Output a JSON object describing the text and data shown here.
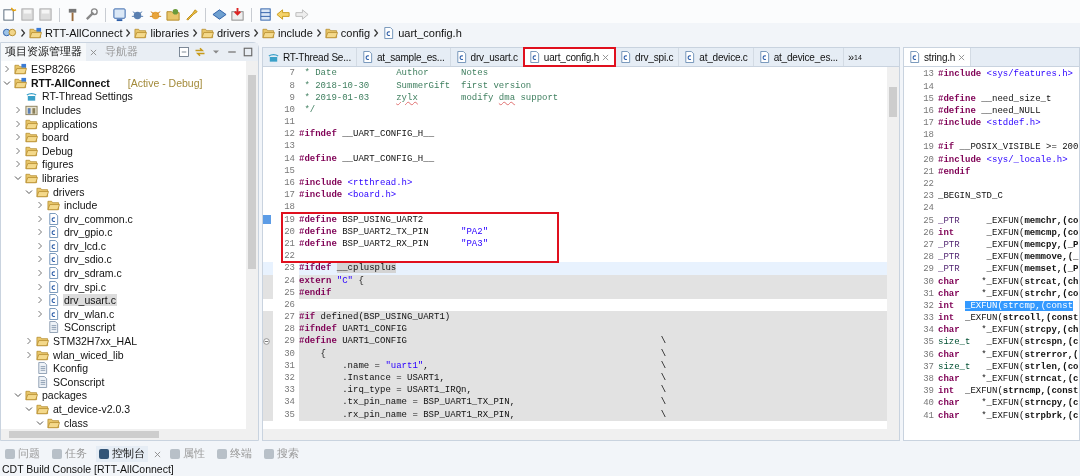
{
  "breadcrumb": [
    {
      "kind": "project",
      "label": "RTT-AllConnect"
    },
    {
      "kind": "folder",
      "label": "libraries"
    },
    {
      "kind": "folder",
      "label": "drivers"
    },
    {
      "kind": "folder",
      "label": "include"
    },
    {
      "kind": "folder",
      "label": "config"
    },
    {
      "kind": "c-file",
      "label": "uart_config.h"
    }
  ],
  "explorer": {
    "tabs": [
      {
        "label": "项目资源管理器",
        "selected": true
      },
      {
        "label": "导航器",
        "selected": false
      }
    ],
    "tree": [
      {
        "kind": "project",
        "label": "ESP8266",
        "expanded": false,
        "selected": false
      },
      {
        "kind": "project",
        "label": "RTT-AllConnect",
        "badge": "[Active - Debug]",
        "expanded": true,
        "selected": false,
        "children": [
          {
            "kind": "settings",
            "label": "RT-Thread Settings",
            "selected": false
          },
          {
            "kind": "includes",
            "label": "Includes",
            "expanded": false,
            "selected": false
          },
          {
            "kind": "folder",
            "label": "applications",
            "expanded": false,
            "selected": false
          },
          {
            "kind": "folder",
            "label": "board",
            "expanded": false,
            "selected": false
          },
          {
            "kind": "folder",
            "label": "Debug",
            "expanded": false,
            "selected": false
          },
          {
            "kind": "folder",
            "label": "figures",
            "expanded": false,
            "selected": false
          },
          {
            "kind": "folder",
            "label": "libraries",
            "expanded": true,
            "selected": false,
            "children": [
              {
                "kind": "folder",
                "label": "drivers",
                "expanded": true,
                "selected": false,
                "children": [
                  {
                    "kind": "folder",
                    "label": "include",
                    "expanded": false,
                    "selected": false
                  },
                  {
                    "kind": "c-file",
                    "label": "drv_common.c",
                    "expanded": false,
                    "selected": false
                  },
                  {
                    "kind": "c-file",
                    "label": "drv_gpio.c",
                    "expanded": false,
                    "selected": false
                  },
                  {
                    "kind": "c-file",
                    "label": "drv_lcd.c",
                    "expanded": false,
                    "selected": false
                  },
                  {
                    "kind": "c-file",
                    "label": "drv_sdio.c",
                    "expanded": false,
                    "selected": false
                  },
                  {
                    "kind": "c-file",
                    "label": "drv_sdram.c",
                    "expanded": false,
                    "selected": false
                  },
                  {
                    "kind": "c-file",
                    "label": "drv_spi.c",
                    "expanded": false,
                    "selected": false
                  },
                  {
                    "kind": "c-file",
                    "label": "drv_usart.c",
                    "expanded": false,
                    "selected": true
                  },
                  {
                    "kind": "c-file",
                    "label": "drv_wlan.c",
                    "expanded": false,
                    "selected": false
                  },
                  {
                    "kind": "text-file",
                    "label": "SConscript",
                    "selected": false
                  }
                ]
              },
              {
                "kind": "folder",
                "label": "STM32H7xx_HAL",
                "expanded": false,
                "selected": false
              },
              {
                "kind": "folder",
                "label": "wlan_wiced_lib",
                "expanded": false,
                "selected": false
              },
              {
                "kind": "text-file",
                "label": "Kconfig",
                "selected": false
              },
              {
                "kind": "text-file",
                "label": "SConscript",
                "selected": false
              }
            ]
          },
          {
            "kind": "folder",
            "label": "packages",
            "expanded": true,
            "selected": false,
            "children": [
              {
                "kind": "folder",
                "label": "at_device-v2.0.3",
                "expanded": true,
                "selected": false,
                "children": [
                  {
                    "kind": "folder",
                    "label": "class",
                    "expanded": true,
                    "selected": false
                  }
                ]
              }
            ]
          }
        ]
      }
    ]
  },
  "editor": {
    "tabs": [
      {
        "kind": "settings",
        "label": "RT-Thread Se...",
        "selected": false,
        "outlined": false
      },
      {
        "kind": "c",
        "label": "at_sample_es...",
        "selected": false,
        "outlined": false
      },
      {
        "kind": "c",
        "label": "drv_usart.c",
        "selected": false,
        "outlined": false
      },
      {
        "kind": "h",
        "label": "uart_config.h",
        "selected": true,
        "outlined": true
      },
      {
        "kind": "c",
        "label": "drv_spi.c",
        "selected": false,
        "outlined": false
      },
      {
        "kind": "c",
        "label": "at_device.c",
        "selected": false,
        "outlined": false
      },
      {
        "kind": "c",
        "label": "at_device_es...",
        "selected": false,
        "outlined": false
      }
    ],
    "overflow": "»",
    "overflow_count": "14",
    "lines": [
      {
        "num": "7",
        "tokens": [
          {
            "kind": "comment",
            "text": " * Date           Author      Notes"
          }
        ]
      },
      {
        "num": "8",
        "tokens": [
          {
            "kind": "comment",
            "text": " * 2018-10-30     SummerGift  first version"
          }
        ]
      },
      {
        "num": "9",
        "tokens": [
          {
            "kind": "comment",
            "text": " * 2019-01-03     "
          },
          {
            "kind": "misspelled",
            "text": "zylx"
          },
          {
            "kind": "comment",
            "text": "        modify "
          },
          {
            "kind": "misspelled",
            "text": "dma"
          },
          {
            "kind": "comment",
            "text": " support"
          }
        ]
      },
      {
        "num": "10",
        "tokens": [
          {
            "kind": "comment",
            "text": " */"
          }
        ]
      },
      {
        "num": "11"
      },
      {
        "num": "12",
        "tokens": [
          {
            "kind": "kw",
            "text": "#ifndef"
          },
          {
            "kind": "plain",
            "text": " __UART_CONFIG_H__"
          }
        ]
      },
      {
        "num": "13"
      },
      {
        "num": "14",
        "tokens": [
          {
            "kind": "kw",
            "text": "#define"
          },
          {
            "kind": "plain",
            "text": " __UART_CONFIG_H__"
          }
        ]
      },
      {
        "num": "15"
      },
      {
        "num": "16",
        "tokens": [
          {
            "kind": "kw",
            "text": "#include "
          },
          {
            "kind": "str",
            "text": "<rtthread.h>"
          }
        ]
      },
      {
        "num": "17",
        "tokens": [
          {
            "kind": "kw",
            "text": "#include "
          },
          {
            "kind": "str",
            "text": "<board.h>"
          }
        ]
      },
      {
        "num": "18"
      },
      {
        "num": "19",
        "bookmark": true,
        "outlined": true,
        "tokens": [
          {
            "kind": "kw",
            "text": "#define"
          },
          {
            "kind": "plain",
            "text": " BSP_USING_UART2"
          }
        ]
      },
      {
        "num": "20",
        "outlined": true,
        "tokens": [
          {
            "kind": "kw",
            "text": "#define"
          },
          {
            "kind": "plain",
            "text": " BSP_UART2_TX_PIN      "
          },
          {
            "kind": "str",
            "text": "\"PA2\""
          }
        ]
      },
      {
        "num": "21",
        "outlined": true,
        "tokens": [
          {
            "kind": "kw",
            "text": "#define"
          },
          {
            "kind": "plain",
            "text": " BSP_UART2_RX_PIN      "
          },
          {
            "kind": "str",
            "text": "\"PA3\""
          }
        ]
      },
      {
        "num": "22",
        "outlined": true
      },
      {
        "num": "23",
        "current": true,
        "tokens": [
          {
            "kind": "kw",
            "text": "#ifdef "
          },
          {
            "kind": "mark",
            "text": "__cplusplus"
          }
        ]
      },
      {
        "num": "24",
        "inactive": true,
        "tokens": [
          {
            "kind": "kw",
            "text": "extern "
          },
          {
            "kind": "str",
            "text": "\"C\""
          },
          {
            "kind": "plain",
            "text": " {"
          }
        ]
      },
      {
        "num": "25",
        "inactive": true,
        "tokens": [
          {
            "kind": "kw",
            "text": "#endif"
          }
        ]
      },
      {
        "num": "26"
      },
      {
        "num": "27",
        "inactive": true,
        "tokens": [
          {
            "kind": "kw",
            "text": "#if"
          },
          {
            "kind": "plain",
            "text": " defined(BSP_USING_UART1)"
          }
        ]
      },
      {
        "num": "28",
        "inactive": true,
        "tokens": [
          {
            "kind": "kw",
            "text": "#ifndef"
          },
          {
            "kind": "plain",
            "text": " UART1_CONFIG"
          }
        ]
      },
      {
        "num": "29",
        "fold": true,
        "inactive": true,
        "tail": "\\",
        "tokens": [
          {
            "kind": "kw",
            "text": "#define"
          },
          {
            "kind": "plain",
            "text": " UART1_CONFIG"
          }
        ]
      },
      {
        "num": "30",
        "inactive": true,
        "tail": "\\",
        "tokens": [
          {
            "kind": "plain",
            "text": "    {"
          }
        ]
      },
      {
        "num": "31",
        "inactive": true,
        "tail": "\\",
        "tokens": [
          {
            "kind": "plain",
            "text": "        .name = "
          },
          {
            "kind": "str",
            "text": "\"uart1\""
          },
          {
            "kind": "plain",
            "text": ","
          }
        ]
      },
      {
        "num": "32",
        "inactive": true,
        "tail": "\\",
        "tokens": [
          {
            "kind": "plain",
            "text": "        .Instance = USART1,"
          }
        ]
      },
      {
        "num": "33",
        "inactive": true,
        "tail": "\\",
        "tokens": [
          {
            "kind": "plain",
            "text": "        .irq_type = USART1_IRQn,"
          }
        ]
      },
      {
        "num": "34",
        "inactive": true,
        "tail": "\\",
        "tokens": [
          {
            "kind": "plain",
            "text": "        .tx_pin_name = BSP_UART1_TX_PIN,"
          }
        ]
      },
      {
        "num": "35",
        "inactive": true,
        "tail": "\\",
        "tokens": [
          {
            "kind": "plain",
            "text": "        .rx_pin_name = BSP_UART1_RX_PIN,"
          }
        ]
      }
    ]
  },
  "side_editor": {
    "tab": {
      "label": "string.h",
      "selected": true
    },
    "lines": [
      {
        "num": "13",
        "tokens": [
          {
            "kind": "kw",
            "text": "#include "
          },
          {
            "kind": "str",
            "text": "<sys/features.h>"
          }
        ]
      },
      {
        "num": "14"
      },
      {
        "num": "15",
        "tokens": [
          {
            "kind": "kw",
            "text": "#define"
          },
          {
            "kind": "plain",
            "text": " __need_size_t"
          }
        ]
      },
      {
        "num": "16",
        "tokens": [
          {
            "kind": "kw",
            "text": "#define"
          },
          {
            "kind": "plain",
            "text": " __need_NULL"
          }
        ]
      },
      {
        "num": "17",
        "tokens": [
          {
            "kind": "kw",
            "text": "#include "
          },
          {
            "kind": "str",
            "text": "<stddef.h>"
          }
        ]
      },
      {
        "num": "18"
      },
      {
        "num": "19",
        "tokens": [
          {
            "kind": "kw",
            "text": "#if"
          },
          {
            "kind": "plain",
            "text": " __POSIX_VISIBLE >= 200"
          }
        ]
      },
      {
        "num": "20",
        "tokens": [
          {
            "kind": "kw",
            "text": "#include "
          },
          {
            "kind": "str",
            "text": "<sys/_locale.h>"
          }
        ]
      },
      {
        "num": "21",
        "tokens": [
          {
            "kind": "kw",
            "text": "#endif"
          }
        ]
      },
      {
        "num": "22"
      },
      {
        "num": "23",
        "tokens": [
          {
            "kind": "plain",
            "text": "_BEGIN_STD_C"
          }
        ]
      },
      {
        "num": "24"
      },
      {
        "num": "25",
        "tokens": [
          {
            "kind": "typedef",
            "text": "_PTR"
          },
          {
            "kind": "plain",
            "text": "     _EXFUN("
          },
          {
            "kind": "fn",
            "text": "memchr,(co"
          }
        ]
      },
      {
        "num": "26",
        "tokens": [
          {
            "kind": "type",
            "text": "int"
          },
          {
            "kind": "plain",
            "text": "      _EXFUN("
          },
          {
            "kind": "fn",
            "text": "memcmp,(co"
          }
        ]
      },
      {
        "num": "27",
        "tokens": [
          {
            "kind": "typedef",
            "text": "_PTR"
          },
          {
            "kind": "plain",
            "text": "     _EXFUN("
          },
          {
            "kind": "fn",
            "text": "memcpy,(_P"
          }
        ]
      },
      {
        "num": "28",
        "tokens": [
          {
            "kind": "typedef",
            "text": "_PTR"
          },
          {
            "kind": "plain",
            "text": "     _EXFUN("
          },
          {
            "kind": "fn",
            "text": "memmove,(_"
          }
        ]
      },
      {
        "num": "29",
        "tokens": [
          {
            "kind": "typedef",
            "text": "_PTR"
          },
          {
            "kind": "plain",
            "text": "     _EXFUN("
          },
          {
            "kind": "fn",
            "text": "memset,(_P"
          }
        ]
      },
      {
        "num": "30",
        "tokens": [
          {
            "kind": "type",
            "text": "char"
          },
          {
            "kind": "plain",
            "text": "    *_EXFUN("
          },
          {
            "kind": "fn",
            "text": "strcat,(ch"
          }
        ]
      },
      {
        "num": "31",
        "tokens": [
          {
            "kind": "type",
            "text": "char"
          },
          {
            "kind": "plain",
            "text": "    *_EXFUN("
          },
          {
            "kind": "fn",
            "text": "strchr,(co"
          }
        ]
      },
      {
        "num": "32",
        "tokens": [
          {
            "kind": "type",
            "text": "int  "
          },
          {
            "kind": "selection",
            "text": "_EXFUN(strcmp,(const"
          }
        ]
      },
      {
        "num": "33",
        "tokens": [
          {
            "kind": "type",
            "text": "int"
          },
          {
            "kind": "plain",
            "text": "  _EXFUN("
          },
          {
            "kind": "fn",
            "text": "strcoll,(const"
          }
        ]
      },
      {
        "num": "34",
        "tokens": [
          {
            "kind": "type",
            "text": "char"
          },
          {
            "kind": "plain",
            "text": "    *_EXFUN("
          },
          {
            "kind": "fn",
            "text": "strcpy,(ch"
          }
        ]
      },
      {
        "num": "35",
        "tokens": [
          {
            "kind": "typename",
            "text": "size_t"
          },
          {
            "kind": "plain",
            "text": "   _EXFUN("
          },
          {
            "kind": "fn",
            "text": "strcspn,(c"
          }
        ]
      },
      {
        "num": "36",
        "tokens": [
          {
            "kind": "type",
            "text": "char"
          },
          {
            "kind": "plain",
            "text": "    *_EXFUN("
          },
          {
            "kind": "fn",
            "text": "strerror,("
          }
        ]
      },
      {
        "num": "37",
        "tokens": [
          {
            "kind": "typename",
            "text": "size_t"
          },
          {
            "kind": "plain",
            "text": "   _EXFUN("
          },
          {
            "kind": "fn",
            "text": "strlen,(co"
          }
        ]
      },
      {
        "num": "38",
        "tokens": [
          {
            "kind": "type",
            "text": "char"
          },
          {
            "kind": "plain",
            "text": "    *_EXFUN("
          },
          {
            "kind": "fn",
            "text": "strncat,(c"
          }
        ]
      },
      {
        "num": "39",
        "tokens": [
          {
            "kind": "type",
            "text": "int"
          },
          {
            "kind": "plain",
            "text": "  _EXFUN("
          },
          {
            "kind": "fn",
            "text": "strncmp,(const"
          }
        ]
      },
      {
        "num": "40",
        "tokens": [
          {
            "kind": "type",
            "text": "char"
          },
          {
            "kind": "plain",
            "text": "    *_EXFUN("
          },
          {
            "kind": "fn",
            "text": "strncpy,(c"
          }
        ]
      },
      {
        "num": "41",
        "tokens": [
          {
            "kind": "type",
            "text": "char"
          },
          {
            "kind": "plain",
            "text": "    *_EXFUN("
          },
          {
            "kind": "fn",
            "text": "strpbrk,(c"
          }
        ]
      }
    ]
  },
  "bottom_panel": {
    "tabs": [
      {
        "label": "问题",
        "selected": false
      },
      {
        "label": "任务",
        "selected": false
      },
      {
        "label": "控制台",
        "selected": true
      },
      {
        "label": "属性",
        "selected": false
      },
      {
        "label": "终端",
        "selected": false
      },
      {
        "label": "搜索",
        "selected": false
      }
    ],
    "console_title": "CDT Build Console [RTT-AllConnect]"
  }
}
